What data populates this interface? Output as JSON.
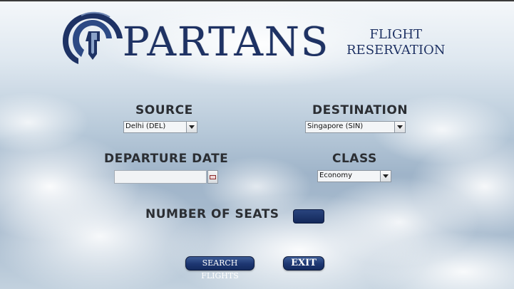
{
  "logo": {
    "word": "PARTANS",
    "sub_line1": "FLIGHT",
    "sub_line2": "RESERVATION"
  },
  "form": {
    "source": {
      "label": "SOURCE",
      "value": "Delhi (DEL)"
    },
    "destination": {
      "label": "DESTINATION",
      "value": "Singapore (SIN)"
    },
    "departure_date": {
      "label": "DEPARTURE DATE",
      "value": ""
    },
    "class": {
      "label": "CLASS",
      "value": "Economy"
    },
    "seats": {
      "label": "NUMBER OF SEATS",
      "value": ""
    }
  },
  "buttons": {
    "search_label": "SEARCH FLIGHTS",
    "exit_label": "EXIT"
  },
  "colors": {
    "brand_navy": "#1e3264",
    "button_navy": "#1d3671"
  }
}
